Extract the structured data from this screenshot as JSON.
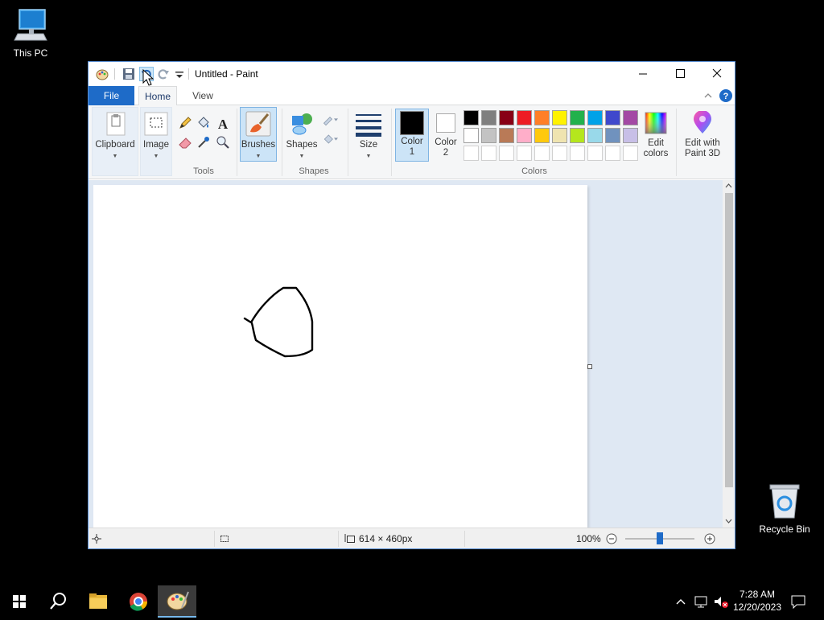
{
  "desktop": {
    "icons": [
      {
        "label": "This PC"
      },
      {
        "label": "Recycle Bin"
      }
    ]
  },
  "window": {
    "title": "Untitled - Paint",
    "tabs": {
      "file": "File",
      "home": "Home",
      "view": "View"
    }
  },
  "ribbon": {
    "clipboard": "Clipboard",
    "image": "Image",
    "tools_group": "Tools",
    "brushes": "Brushes",
    "shapes": "Shapes",
    "shapes_group": "Shapes",
    "size": "Size",
    "color1": "Color\n1",
    "color2": "Color\n2",
    "colors_group": "Colors",
    "edit_colors": "Edit\ncolors",
    "edit_paint3d": "Edit with\nPaint 3D",
    "palette_row1": [
      "#000000",
      "#7f7f7f",
      "#880015",
      "#ed1c24",
      "#ff7f27",
      "#fff200",
      "#22b14c",
      "#00a2e8",
      "#3f48cc",
      "#a349a4"
    ],
    "palette_row2": [
      "#ffffff",
      "#c3c3c3",
      "#b97a57",
      "#ffaec9",
      "#ffc90e",
      "#efe4b0",
      "#b5e61d",
      "#99d9ea",
      "#7092be",
      "#c8bfe7"
    ],
    "color1_value": "#000000",
    "color2_value": "#ffffff"
  },
  "status": {
    "image_size": "614 × 460px",
    "zoom": "100%",
    "zoom_level": 0.5
  },
  "taskbar": {
    "time": "7:28 AM",
    "date": "12/20/2023"
  }
}
